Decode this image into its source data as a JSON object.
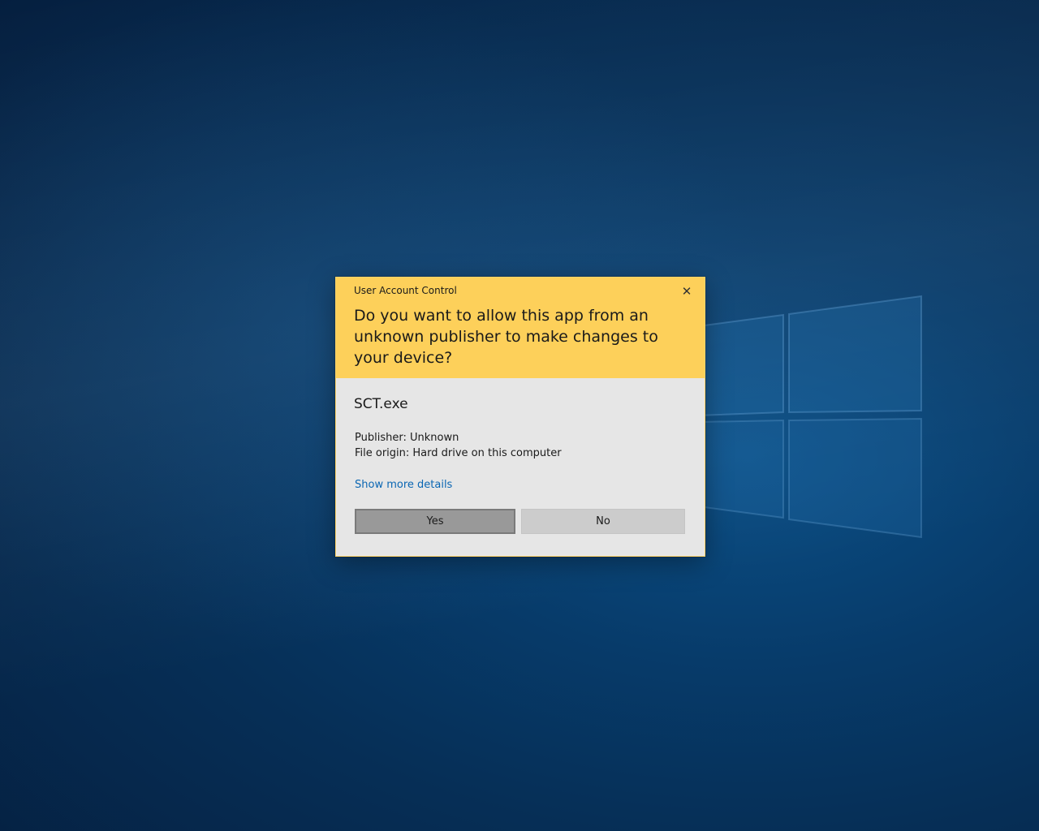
{
  "dialog": {
    "title": "User Account Control",
    "question": "Do you want to allow this app from an unknown publisher to make changes to your device?",
    "app_name": "SCT.exe",
    "publisher": "Publisher: Unknown",
    "file_origin": "File origin: Hard drive on this computer",
    "details_link": "Show more details",
    "yes_label": "Yes",
    "no_label": "No",
    "close_glyph": "✕"
  },
  "colors": {
    "header": "#fdd05a",
    "body": "#e6e6e6",
    "link": "#0a66b3",
    "yes_button": "#999999",
    "no_button": "#cccccc",
    "desktop": "#063866"
  },
  "icons": {
    "close": "close-icon",
    "wallpaper_logo": "windows-logo-icon"
  }
}
